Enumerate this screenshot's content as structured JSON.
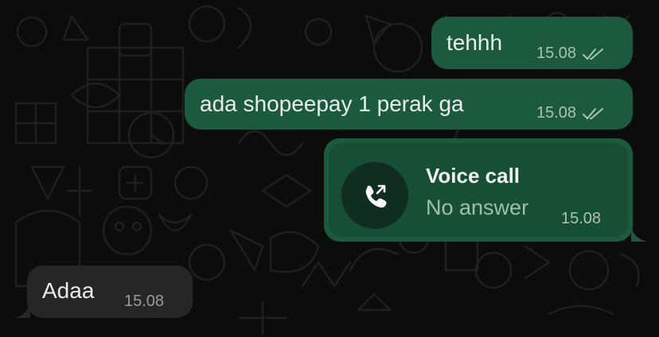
{
  "messages": [
    {
      "id": "m1",
      "direction": "outgoing",
      "text": "tehhh",
      "time": "15.08",
      "status": "read"
    },
    {
      "id": "m2",
      "direction": "outgoing",
      "text": "ada shopeepay 1 perak ga",
      "time": "15.08",
      "status": "read"
    },
    {
      "id": "m3",
      "direction": "outgoing",
      "type": "voice_call",
      "title": "Voice call",
      "subtitle": "No answer",
      "time": "15.08",
      "icon": "outgoing-call-icon"
    },
    {
      "id": "m4",
      "direction": "incoming",
      "text": "Adaa",
      "time": "15.08"
    }
  ],
  "colors": {
    "outgoing_bubble": "#1b5a3e",
    "incoming_bubble": "#262626",
    "background": "#0c0c0c"
  }
}
